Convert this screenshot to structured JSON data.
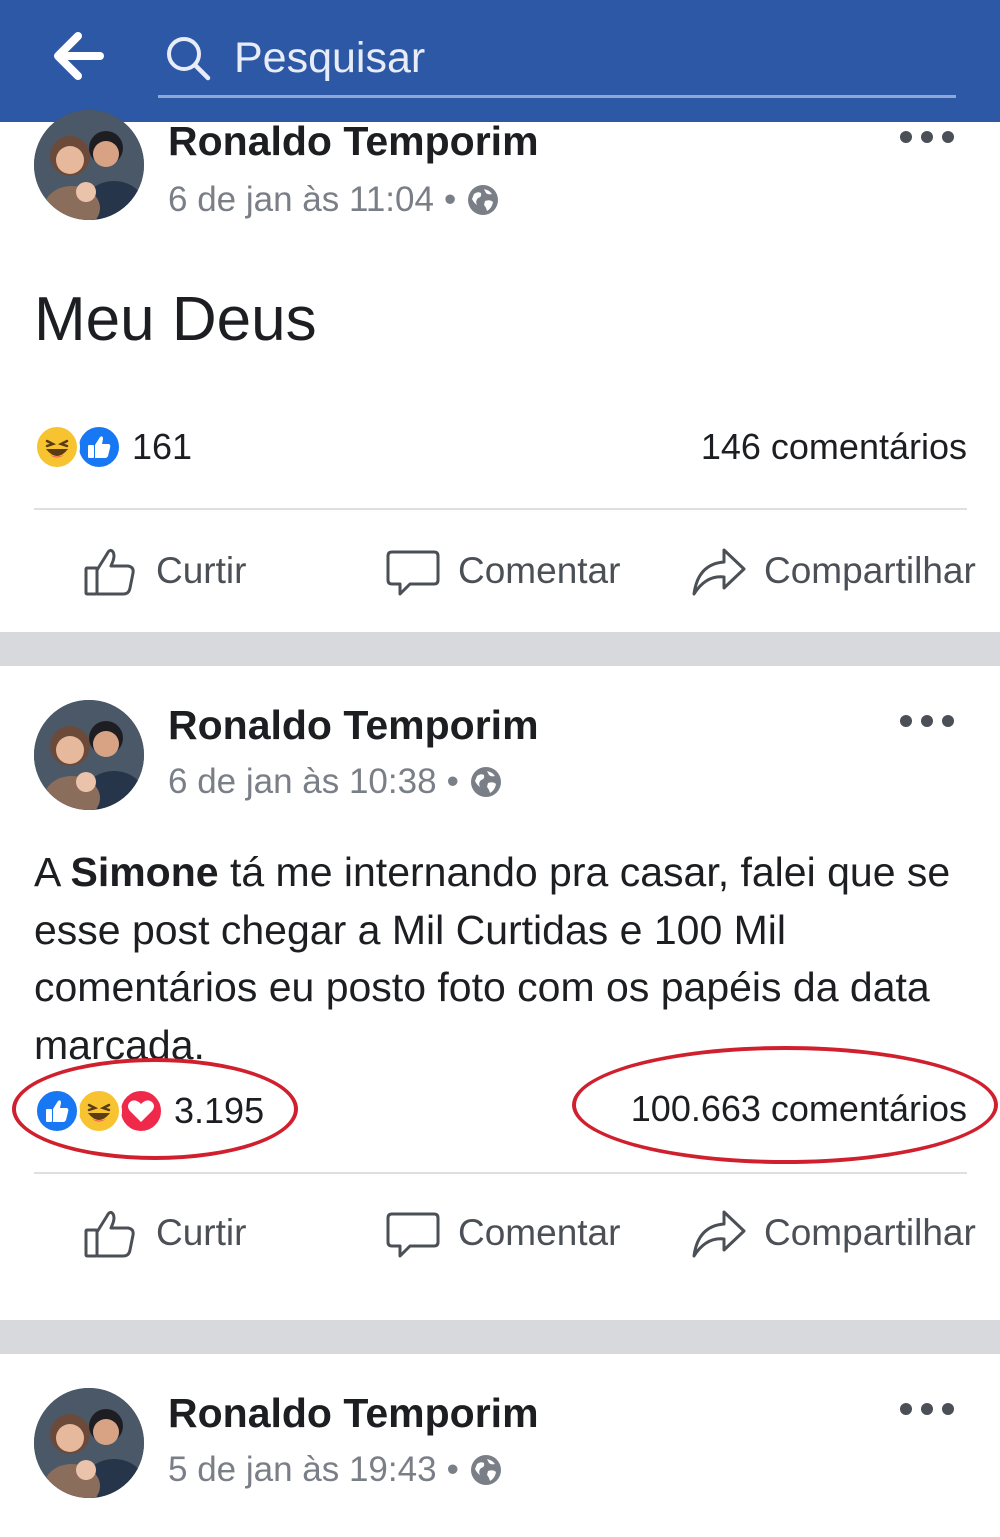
{
  "header": {
    "search_placeholder": "Pesquisar",
    "color": "#2d58a6"
  },
  "posts": [
    {
      "author": "Ronaldo Temporim",
      "time": "6 de jan às 11:04",
      "text": "Meu Deus",
      "reactions": [
        "haha",
        "like"
      ],
      "reaction_count": "161",
      "comments": "146 comentários"
    },
    {
      "author": "Ronaldo Temporim",
      "time": "6 de jan às 10:38",
      "text_prefix": "A ",
      "text_mention": "Simone",
      "text_rest": " tá me internando pra casar, falei que se esse post chegar a Mil Curtidas e 100 Mil comentários eu posto foto com os papéis da data marcada.",
      "reactions": [
        "like",
        "haha",
        "love"
      ],
      "reaction_count": "3.195",
      "comments": "100.663 comentários",
      "highlighted": true
    },
    {
      "author": "Ronaldo Temporim",
      "time": "5 de jan às 19:43"
    }
  ],
  "actions": {
    "like": "Curtir",
    "comment": "Comentar",
    "share": "Compartilhar"
  },
  "meta": {
    "separator": "•",
    "privacy_icon": "globe-icon"
  },
  "colors": {
    "like": "#1877f2",
    "haha": "#f7c331",
    "love": "#f0284a",
    "highlight": "#d0202e"
  }
}
